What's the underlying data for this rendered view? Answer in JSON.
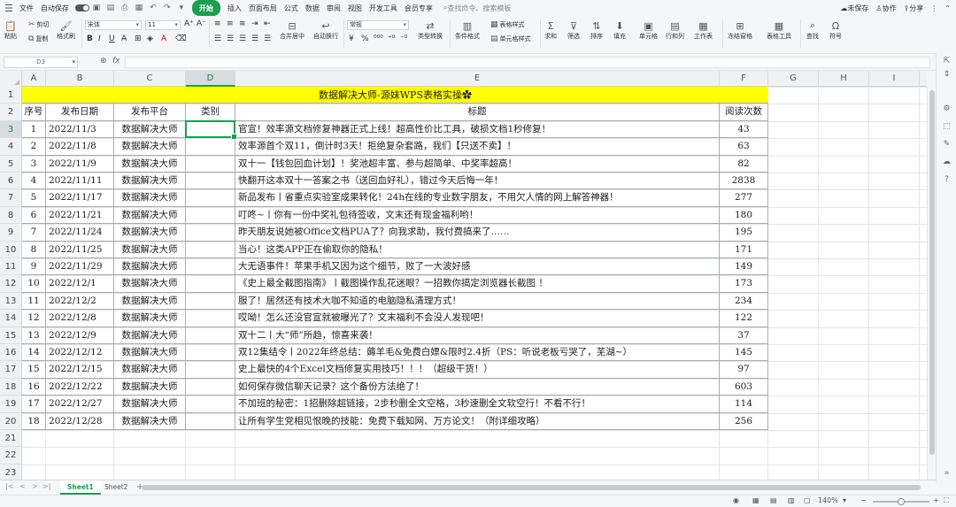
{
  "menubar": {
    "file": "文件",
    "autosave": "自动保存",
    "tabs": [
      "开始",
      "插入",
      "页面布局",
      "公式",
      "数据",
      "审阅",
      "视图",
      "开发工具",
      "会员专享"
    ],
    "search": "查找命令、搜索模板",
    "unsaved": "未保存",
    "collab": "协作",
    "share": "分享"
  },
  "ribbon": {
    "paste": "粘贴",
    "cut": "剪切",
    "copy": "复制",
    "format_painter": "格式刷",
    "font_name": "宋体",
    "font_size": "11",
    "merge_center": "合并居中",
    "wrap": "自动换行",
    "number_format": "常规",
    "type_convert": "类型转换",
    "cond_format": "条件格式",
    "table_style": "表格样式",
    "cell_style": "单元格样式",
    "sum": "求和",
    "filter": "筛选",
    "sort": "排序",
    "fill": "填充",
    "cells": "单元格",
    "rowcol": "行和列",
    "worksheet": "工作表",
    "freeze": "冻结窗格",
    "table_tools": "表格工具",
    "find": "查找",
    "symbol": "符号"
  },
  "formula": {
    "namebox": "D3",
    "fx": "fx",
    "value": ""
  },
  "columns": [
    "A",
    "B",
    "C",
    "D",
    "E",
    "F",
    "G",
    "H",
    "I"
  ],
  "rows": [
    "1",
    "2",
    "3",
    "4",
    "5",
    "6",
    "7",
    "8",
    "9",
    "10",
    "11",
    "12",
    "13",
    "14",
    "15",
    "16",
    "17",
    "18",
    "19",
    "20",
    "21",
    "22",
    "23",
    "24",
    "25"
  ],
  "sheet": {
    "title": "数据解决大师-源妹WPS表格实操✿",
    "headers": [
      "序号",
      "发布日期",
      "发布平台",
      "类别",
      "标题",
      "阅读次数"
    ],
    "records": [
      [
        "1",
        "2022/11/3",
        "数据解决大师",
        "",
        "官宣！效率源文档修复神器正式上线！超高性价比工具，破损文档1秒修复！",
        "43"
      ],
      [
        "2",
        "2022/11/8",
        "数据解决大师",
        "",
        "效率源首个双11，倒计时3天！拒绝复杂套路，我们【只送不卖】！",
        "63"
      ],
      [
        "3",
        "2022/11/9",
        "数据解决大师",
        "",
        "双十一【钱包回血计划】！奖池超丰富、参与超简单、中奖率超高！",
        "82"
      ],
      [
        "4",
        "2022/11/11",
        "数据解决大师",
        "",
        "快翻开这本双十一答案之书（送回血好礼），错过今天后悔一年！",
        "2838"
      ],
      [
        "5",
        "2022/11/17",
        "数据解决大师",
        "",
        "新品发布丨省重点实验室成果转化！24h在线的专业数字朋友，不用欠人情的网上解答神器！",
        "277"
      ],
      [
        "6",
        "2022/11/21",
        "数据解决大师",
        "",
        "叮咚~丨你有一份中奖礼包待签收，文末还有现金福利哟！",
        "180"
      ],
      [
        "7",
        "2022/11/24",
        "数据解决大师",
        "",
        "昨天朋友说她被Office文档PUA了？向我求助，我付费搞来了……",
        "195"
      ],
      [
        "8",
        "2022/11/25",
        "数据解决大师",
        "",
        "当心！这类APP正在偷取你的隐私！",
        "171"
      ],
      [
        "9",
        "2022/11/29",
        "数据解决大师",
        "",
        "大无语事件！苹果手机又因为这个细节，败了一大波好感",
        "149"
      ],
      [
        "10",
        "2022/12/1",
        "数据解决大师",
        "",
        "《史上最全截图指南》丨截图操作乱花迷眼？一招教你搞定浏览器长截图 ！",
        "173"
      ],
      [
        "11",
        "2022/12/2",
        "数据解决大师",
        "",
        "服了！居然还有技术大咖不知道的电脑隐私清理方式！",
        "234"
      ],
      [
        "12",
        "2022/12/8",
        "数据解决大师",
        "",
        "哎呦！怎么还没官宣就被曝光了？文末福利不会没人发现吧！",
        "122"
      ],
      [
        "13",
        "2022/12/9",
        "数据解决大师",
        "",
        "双十二丨大“师”所趋，惊喜来袭！",
        "37"
      ],
      [
        "14",
        "2022/12/12",
        "数据解决大师",
        "",
        "双12集结令丨2022年终总结：薅羊毛&免费白嫖&限时2.4折（PS：听说老板亏哭了，芜湖~）",
        "145"
      ],
      [
        "15",
        "2022/12/15",
        "数据解决大师",
        "",
        "史上最快的4个Excel文档修复实用技巧！！！（超级干货！）",
        "97"
      ],
      [
        "16",
        "2022/12/22",
        "数据解决大师",
        "",
        "如何保存微信聊天记录？这个备份方法绝了！",
        "603"
      ],
      [
        "17",
        "2022/12/27",
        "数据解决大师",
        "",
        "不加班的秘密：1招删除超链接，2步秒删全文空格，3秒速删全文软空行！不看不行！",
        "114"
      ],
      [
        "18",
        "2022/12/28",
        "数据解决大师",
        "",
        "让所有学生党相见恨晚的技能：免费下载知网、万方论文！（附详细攻略）",
        "256"
      ]
    ]
  },
  "tabs": {
    "sheets": [
      "Sheet1",
      "Sheet2"
    ],
    "add": "+"
  },
  "status": {
    "zoom": "140%",
    "zoom_minus": "−",
    "zoom_plus": "+"
  }
}
